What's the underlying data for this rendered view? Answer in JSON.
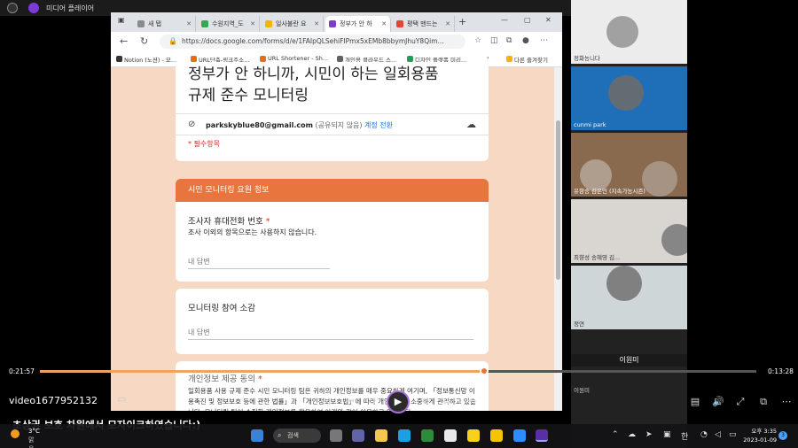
{
  "player": {
    "title": "미디어 플레이어",
    "video_name": "video1677952132",
    "elapsed": "0:21:57",
    "remaining": "0:13:28",
    "progress_fraction": 0.62,
    "caption": "초상권 보호 차원에서 모자이크하였습니다:)"
  },
  "browser": {
    "tabs": [
      {
        "label": "새 탭",
        "color": "#8a8a8a"
      },
      {
        "label": "수원지역_도",
        "color": "#34a853"
      },
      {
        "label": "일사불란 요",
        "color": "#f4b400"
      },
      {
        "label": "정부가 안 하",
        "color": "#7b3fc4"
      },
      {
        "label": "평택 맨드는",
        "color": "#ea4335"
      }
    ],
    "url": "https://docs.google.com/forms/d/e/1FAIpQLSehiFIPmx5xEMb8bbymJhuY8Qim...",
    "bookmarks": [
      {
        "label": "Notion (노션) - 모...",
        "color": "#333333"
      },
      {
        "label": "URL단축-링크주소...",
        "color": "#e46d1f"
      },
      {
        "label": "URL Shortener - Sh...",
        "color": "#e46d1f"
      },
      {
        "label": "개인용 클라우드 스...",
        "color": "#5f6368"
      },
      {
        "label": "디자인 플랫폼 미리...",
        "color": "#1ea05a"
      },
      {
        "label": "다른 즐겨찾기",
        "color": "#f4b400"
      }
    ]
  },
  "form": {
    "title_line1": "정부가 안 하니까, 시민이 하는 일회용품",
    "title_line2": "규제 준수 모니터링",
    "account_email": "parkskyblue80@gmail.com",
    "account_note": "(공유되지 않음)",
    "account_switch": "계정 전환",
    "required_note": "* 필수항목",
    "section_title": "시민 모니터링 요원 정보",
    "q1": {
      "title": "조사자 휴대전화 번호",
      "required": "*",
      "desc": "조사 이외의 항목으로는 사용하지 않습니다.",
      "placeholder": "내 답변"
    },
    "q2": {
      "title": "모니터링 참여 소감",
      "placeholder": "내 답변"
    },
    "q3": {
      "title": "개인정보 제공 동의",
      "required": "*",
      "text": "일회용품 사용 규제 준수 시민 모니터링 팀은 귀하의 개인정보를 매우 중요하게 여기며, 「정보통신망 이용촉진 및 정보보호 등에 관한 법률」과 「개인정보보호법」에 따라 개인정보를 소중하게 관리하고 있습니다. 모니터링 팀이 수집한 개인정보를 활용하여 아래와 같이 이용하고 있습니다."
    }
  },
  "gallery": {
    "tiles": [
      {
        "name": "정화능니다"
      },
      {
        "name": "cunmi park"
      },
      {
        "name": "유항승 김은민 (지속가능시즌)"
      },
      {
        "name": "최향성 송혜영 김..."
      },
      {
        "name": "정연"
      }
    ],
    "speaker": "이원미",
    "sub": "이원미"
  },
  "taskbar": {
    "temp": "3°C",
    "condition": "맑음",
    "search": "검색",
    "ime": "한",
    "time": "오후 3:35",
    "date": "2023-01-09",
    "notif_count": "3"
  }
}
